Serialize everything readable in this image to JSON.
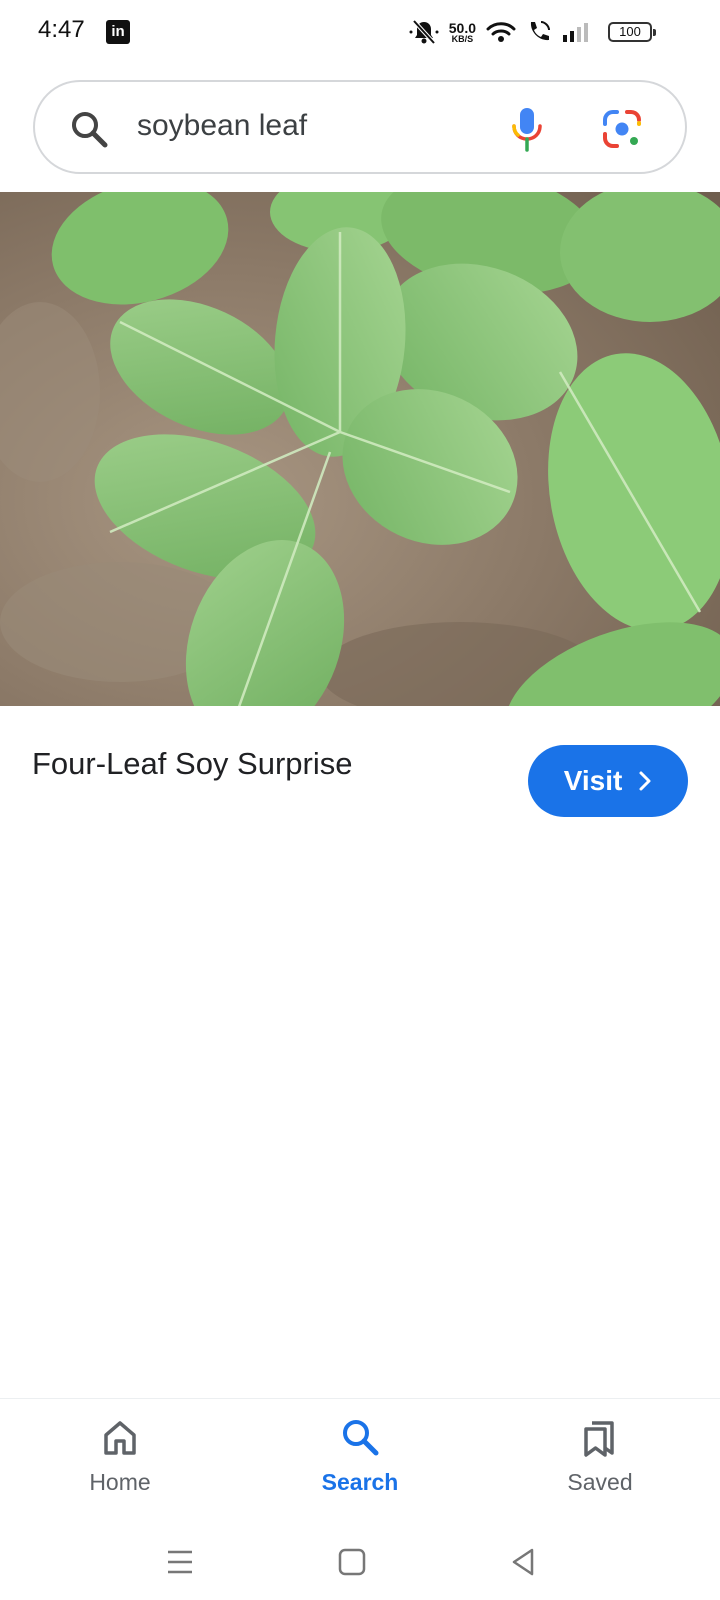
{
  "status_bar": {
    "time": "4:47",
    "net_speed_value": "50.0",
    "net_speed_unit": "KB/S",
    "battery_level": "100"
  },
  "search": {
    "query": "soybean leaf"
  },
  "result": {
    "title": "Four-Leaf Soy Surprise",
    "visit_label": "Visit"
  },
  "bottom_nav": {
    "items": [
      {
        "label": "Home",
        "icon": "home-icon"
      },
      {
        "label": "Search",
        "icon": "search-icon"
      },
      {
        "label": "Saved",
        "icon": "saved-icon"
      }
    ],
    "active": "Search"
  },
  "colors": {
    "accent": "#1a73e8",
    "text": "#202124",
    "muted": "#5f6368"
  }
}
